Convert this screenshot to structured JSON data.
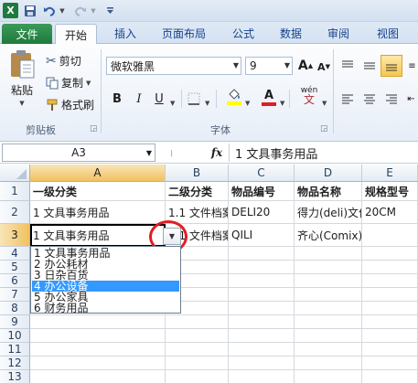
{
  "title_bar": {
    "app_letter": "X",
    "undo_icon": "undo-icon",
    "redo_icon": "redo-icon",
    "customize_icon": "customize-qat-icon"
  },
  "tabs": [
    {
      "label": "文件"
    },
    {
      "label": "开始"
    },
    {
      "label": "插入"
    },
    {
      "label": "页面布局"
    },
    {
      "label": "公式"
    },
    {
      "label": "数据"
    },
    {
      "label": "审阅"
    },
    {
      "label": "视图"
    }
  ],
  "ribbon": {
    "clipboard": {
      "paste_label": "粘贴",
      "cut_label": "剪切",
      "copy_label": "复制",
      "format_painter_label": "格式刷",
      "group_label": "剪贴板"
    },
    "font": {
      "font_name": "微软雅黑",
      "font_size": "9",
      "grow_font": "A",
      "shrink_font": "A",
      "bold": "B",
      "italic": "I",
      "underline": "U",
      "font_color": "A",
      "phonetic": "wén",
      "group_label": "字体"
    }
  },
  "formula_bar": {
    "name_box": "A3",
    "fx_label": "fx",
    "content": "1  文具事务用品"
  },
  "grid": {
    "columns": [
      "A",
      "B",
      "C",
      "D",
      "E"
    ],
    "rows": [
      "1",
      "2",
      "3",
      "4",
      "5",
      "6",
      "7",
      "8",
      "9",
      "10",
      "11",
      "12",
      "13"
    ],
    "cells": {
      "A1": "一级分类",
      "B1": "二级分类",
      "C1": "物品编号",
      "D1": "物品名称",
      "E1": "规格型号",
      "A2": "1 文具事务用品",
      "B2": "1.1 文件档案",
      "C2": "DELI20",
      "D2": "得力(deli)文件",
      "E2": "20CM",
      "A3": "1 文具事务用品",
      "B3": "1.1 文件档案",
      "C3": "QILI",
      "D3": "齐心(Comix)七层文件柜",
      "E3": ""
    }
  },
  "dropdown": {
    "options": [
      "1  文具事务用品",
      "2  办公耗材",
      "3  日杂百货",
      "4  办公设备",
      "5  办公家具",
      "6  财务用品"
    ],
    "selected_index": 3
  },
  "colors": {
    "file_tab": "#1e7a3c",
    "selection_highlight": "#3399ff",
    "annotation_circle": "#e11d24",
    "active_header": "#f1c15f"
  }
}
